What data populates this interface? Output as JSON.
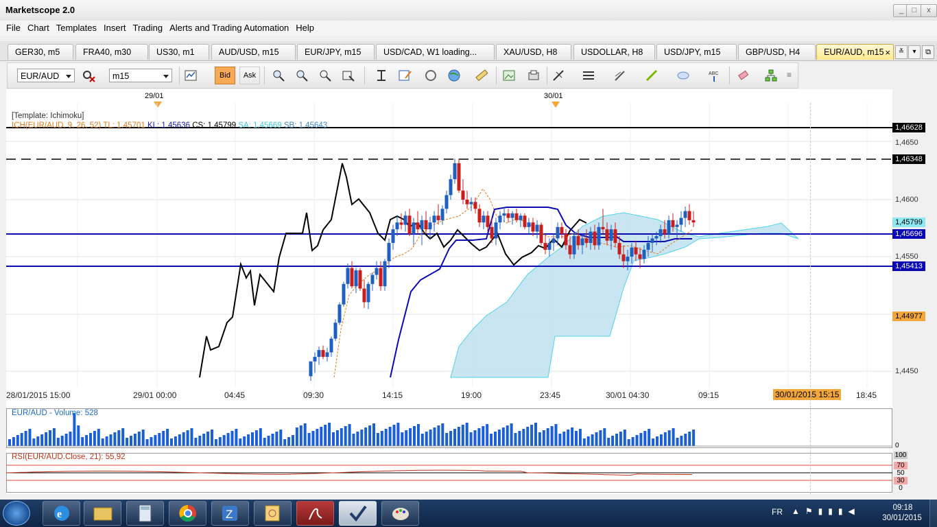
{
  "window": {
    "title": "Marketscope 2.0",
    "buttons": [
      "_",
      "□",
      "x"
    ]
  },
  "menu": [
    "File",
    "Chart",
    "Templates",
    "Insert",
    "Trading",
    "Alerts and Trading Automation",
    "Help"
  ],
  "tabs": [
    {
      "label": "GER30, m5"
    },
    {
      "label": "FRA40, m30"
    },
    {
      "label": "US30, m1"
    },
    {
      "label": "AUD/USD, m15"
    },
    {
      "label": "EUR/JPY, m15"
    },
    {
      "label": "USD/CAD, W1 loading..."
    },
    {
      "label": "XAU/USD, H8"
    },
    {
      "label": "USDOLLAR, H8"
    },
    {
      "label": "USD/JPY, m15"
    },
    {
      "label": "GBP/USD, H4"
    },
    {
      "label": "EUR/AUD, m15"
    }
  ],
  "tab_close": "×",
  "toolbar": {
    "symbol": "EUR/AUD",
    "timeframe": "m15",
    "bid_label": "Bid",
    "ask_label": "Ask"
  },
  "chart": {
    "date_markers": [
      "29/01",
      "30/01"
    ],
    "template_label": "[Template: Ichimoku]",
    "indicator": {
      "name": "ICH(EUR/AUD, 9, 26, 52)",
      "tl": "TL: 1,45701",
      "kl": "KL: 1,45636",
      "cs": "CS: 1,45799",
      "sa": "SA: 1,45669",
      "sb": "SB: 1,45643"
    },
    "price_axis": [
      "1,4650",
      "1,4600",
      "1,4550",
      "1,4450"
    ],
    "price_tags": [
      {
        "value": "1,46628",
        "bg": "#000000",
        "fg": "#ffffff"
      },
      {
        "value": "1,46348",
        "bg": "#000000",
        "fg": "#ffffff"
      },
      {
        "value": "1,45799",
        "bg": "#8fe9f2",
        "fg": "#000000"
      },
      {
        "value": "1,45696",
        "bg": "#0a0ab4",
        "fg": "#ffffff"
      },
      {
        "value": "1,45413",
        "bg": "#0a0ab4",
        "fg": "#ffffff"
      },
      {
        "value": "1,44977",
        "bg": "#f3a63a",
        "fg": "#000000"
      }
    ],
    "time_axis": [
      "28/01/2015 15:00",
      "29/01 00:00",
      "04:45",
      "09:30",
      "14:15",
      "19:00",
      "23:45",
      "30/01 04:30",
      "09:15",
      "18:45"
    ],
    "cursor_time": "30/01/2015 15:15",
    "colors": {
      "bull": "#1f5fbf",
      "bear": "#c81e1e",
      "kijun": "#0a0ab4",
      "chikou": "#000000",
      "tenkan": "#e07b1a",
      "cloud": "#bfe0ee",
      "cloud_edge": "#4fd4e6",
      "hline_blue": "#0a0ab4"
    }
  },
  "volume": {
    "label": "EUR/AUD - Volume: 528",
    "zero_label": "0"
  },
  "rsi": {
    "label": "RSI(EUR/AUD.Close, 21): 55,92",
    "levels": [
      "100",
      "70",
      "50",
      "30",
      "0"
    ]
  },
  "taskbar": {
    "lang": "FR",
    "time": "09:18",
    "date": "30/01/2015"
  }
}
